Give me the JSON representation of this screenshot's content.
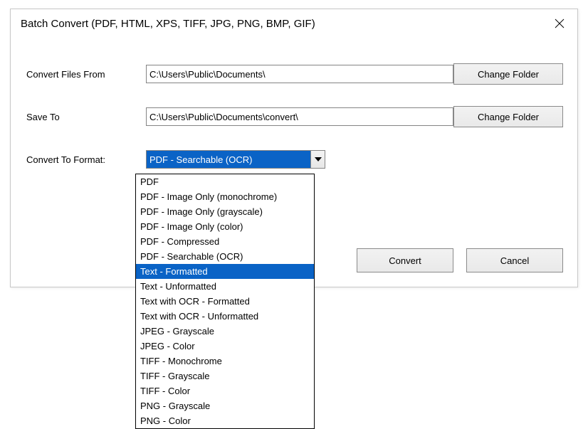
{
  "titlebar": {
    "title": "Batch Convert (PDF, HTML, XPS, TIFF, JPG, PNG, BMP, GIF)"
  },
  "labels": {
    "from": "Convert Files From",
    "saveTo": "Save To",
    "format": "Convert To Format:"
  },
  "paths": {
    "from": "C:\\Users\\Public\\Documents\\",
    "saveTo": "C:\\Users\\Public\\Documents\\convert\\"
  },
  "buttons": {
    "changeFolder": "Change Folder",
    "convert": "Convert",
    "cancel": "Cancel"
  },
  "combo": {
    "selected": "PDF - Searchable (OCR)",
    "highlightIndex": 6,
    "options": [
      "PDF",
      "PDF - Image Only (monochrome)",
      "PDF - Image Only (grayscale)",
      "PDF - Image Only (color)",
      "PDF - Compressed",
      "PDF - Searchable (OCR)",
      "Text - Formatted",
      "Text - Unformatted",
      "Text with OCR - Formatted",
      "Text with OCR - Unformatted",
      "JPEG - Grayscale",
      "JPEG - Color",
      "TIFF - Monochrome",
      "TIFF - Grayscale",
      "TIFF - Color",
      "PNG - Grayscale",
      "PNG - Color"
    ]
  }
}
